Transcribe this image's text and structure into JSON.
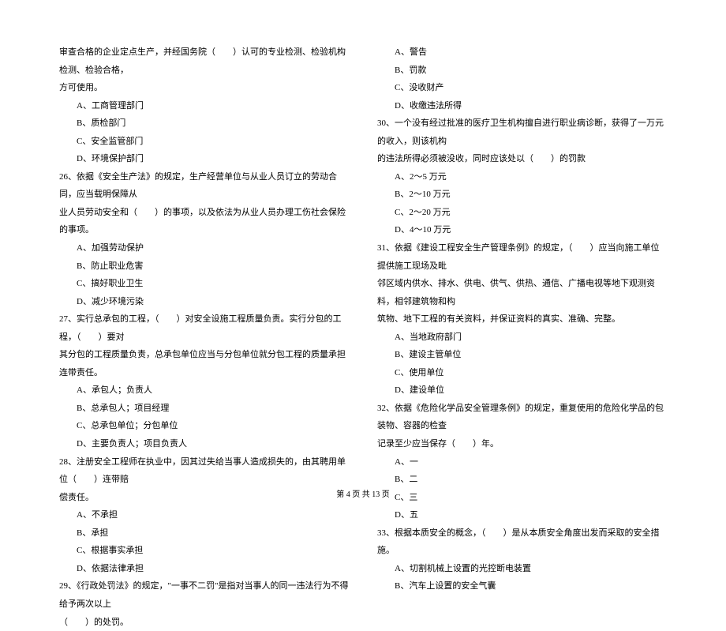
{
  "left": {
    "l1": "审查合格的企业定点生产，并经国务院（　　）认可的专业检测、检验机构检测、检验合格，",
    "l2": "方可使用。",
    "l3": "A、工商管理部门",
    "l4": "B、质检部门",
    "l5": "C、安全监管部门",
    "l6": "D、环境保护部门",
    "l7": "26、依据《安全生产法》的规定，生产经营单位与从业人员订立的劳动合同，应当载明保障从",
    "l8": "业人员劳动安全和（　　）的事项，以及依法为从业人员办理工伤社会保险的事项。",
    "l9": "A、加强劳动保护",
    "l10": "B、防止职业危害",
    "l11": "C、搞好职业卫生",
    "l12": "D、减少环境污染",
    "l13": "27、实行总承包的工程，（　　）对安全设施工程质量负责。实行分包的工程，（　　）要对",
    "l14": "其分包的工程质量负责，总承包单位应当与分包单位就分包工程的质量承担连带责任。",
    "l15": "A、承包人；负责人",
    "l16": "B、总承包人；项目经理",
    "l17": "C、总承包单位；分包单位",
    "l18": "D、主要负责人；项目负责人",
    "l19": "28、注册安全工程师在执业中，因其过失给当事人造成损失的，由其聘用单位（　　）连带赔",
    "l20": "偿责任。",
    "l21": "A、不承担",
    "l22": "B、承担",
    "l23": "C、根据事实承担",
    "l24": "D、依据法律承担",
    "l25": "29、《行政处罚法》的规定，\"一事不二罚\"是指对当事人的同一违法行为不得给予两次以上",
    "l26": "（　　）的处罚。"
  },
  "right": {
    "r1": "A、警告",
    "r2": "B、罚款",
    "r3": "C、没收财产",
    "r4": "D、收缴违法所得",
    "r5": "30、一个没有经过批准的医疗卫生机构擅自进行职业病诊断，获得了一万元的收入，则该机构",
    "r6": "的违法所得必须被没收，同时应该处以（　　）的罚款",
    "r7": "A、2～5 万元",
    "r8": "B、2～10 万元",
    "r9": "C、2～20 万元",
    "r10": "D、4～10 万元",
    "r11": "31、依据《建设工程安全生产管理条例》的规定，（　　）应当向施工单位提供施工现场及毗",
    "r12": "邻区域内供水、排水、供电、供气、供热、通信、广播电视等地下观测资料，相邻建筑物和构",
    "r13": "筑物、地下工程的有关资料，并保证资料的真实、准确、完整。",
    "r14": "A、当地政府部门",
    "r15": "B、建设主管单位",
    "r16": "C、使用单位",
    "r17": "D、建设单位",
    "r18": "32、依据《危险化学品安全管理条例》的规定，重复使用的危险化学品的包装物、容器的检查",
    "r19": "记录至少应当保存（　　）年。",
    "r20": "A、一",
    "r21": "B、二",
    "r22": "C、三",
    "r23": "D、五",
    "r24": "33、根据本质安全的概念，（　　）是从本质安全角度出发而采取的安全措施。",
    "r25": "A、切割机械上设置的光控断电装置",
    "r26": "B、汽车上设置的安全气囊"
  },
  "footer": "第 4 页 共 13 页"
}
